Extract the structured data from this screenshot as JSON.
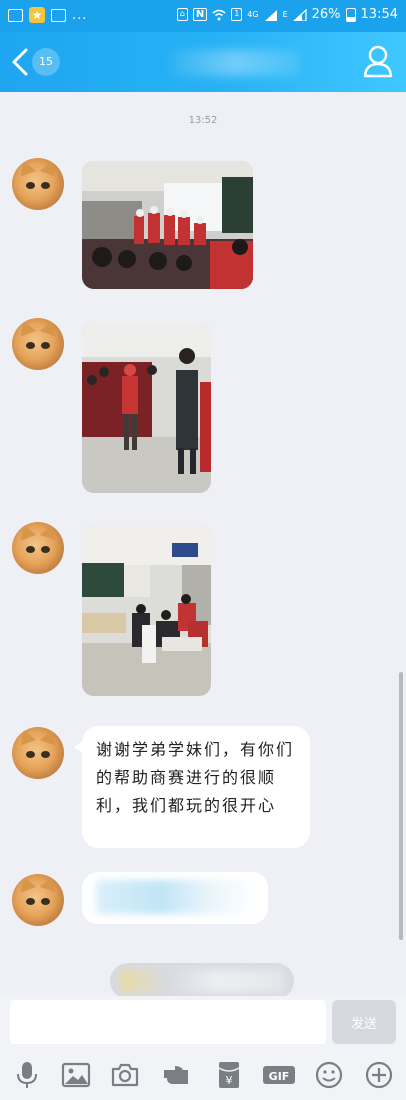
{
  "status_bar": {
    "network_4g": "4G",
    "network_e": "E",
    "sim_number": "1",
    "nfc_label": "N",
    "battery_percent": "26%",
    "time": "13:54",
    "overflow_dots": "..."
  },
  "header": {
    "unread_count": "15",
    "title": "",
    "back_icon": "back-arrow-icon",
    "profile_icon": "person-icon"
  },
  "chat": {
    "timestamp": "13:52",
    "messages": [
      {
        "type": "image",
        "description_icon": "photo"
      },
      {
        "type": "image",
        "description_icon": "photo"
      },
      {
        "type": "image",
        "description_icon": "photo"
      },
      {
        "type": "text",
        "text": "谢谢学弟学妹们，有你们的帮助商赛进行的很顺利，我们都玩的很开心"
      },
      {
        "type": "text",
        "text": ""
      }
    ]
  },
  "composer": {
    "input_value": "",
    "send_label": "发送"
  },
  "toolbar": {
    "items": [
      "mic-icon",
      "image-icon",
      "camera-icon",
      "sticker-icon",
      "red-packet-icon",
      "gif-icon",
      "emoji-icon",
      "plus-icon"
    ],
    "gif_label": "GIF",
    "red_packet_label": "¥"
  },
  "colors": {
    "header_blue": "#1ea6f0",
    "chat_bg": "#eef0f5",
    "bubble_bg": "#ffffff"
  }
}
